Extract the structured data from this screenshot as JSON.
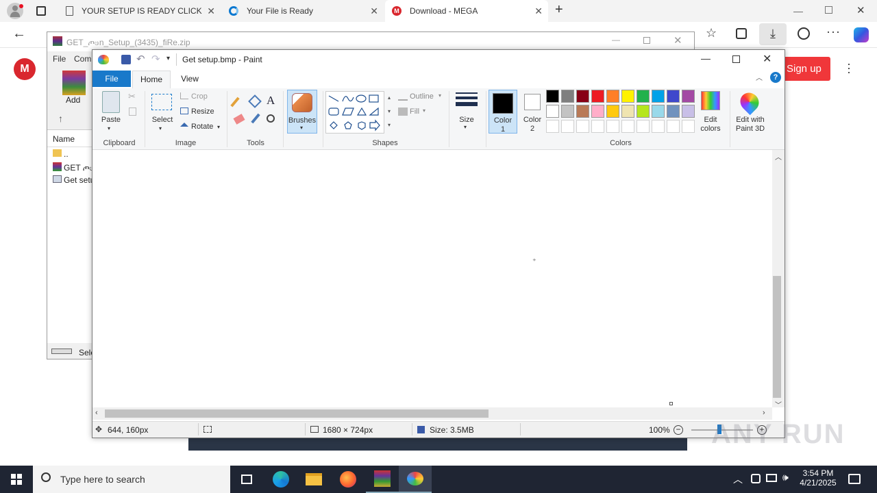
{
  "browser": {
    "tabs": [
      {
        "title": "YOUR SETUP IS READY CLICK BEL",
        "icon": "page-icon"
      },
      {
        "title": "Your File is Ready",
        "icon": "loading-icon"
      },
      {
        "title": "Download - MEGA",
        "icon": "mega-icon"
      }
    ],
    "mega_signup": "Sign up",
    "mega_logo": "M"
  },
  "winrar": {
    "title": "GET_ጦဖn_Setup_(3435)_fiRe.zip",
    "menu": [
      "File",
      "Com"
    ],
    "add_label": "Add",
    "column_name": "Name",
    "files": [
      "..",
      "GET ጦဖ",
      "Get setu"
    ],
    "status": "Sele"
  },
  "paint": {
    "title": "Get setup.bmp - Paint",
    "tabs": {
      "file": "File",
      "home": "Home",
      "view": "View"
    },
    "clipboard": {
      "paste": "Paste",
      "label": "Clipboard"
    },
    "image": {
      "select": "Select",
      "crop": "Crop",
      "resize": "Resize",
      "rotate": "Rotate",
      "label": "Image"
    },
    "tools": {
      "label": "Tools"
    },
    "brushes": "Brushes",
    "shapes": {
      "outline": "Outline",
      "fill": "Fill",
      "label": "Shapes"
    },
    "size": "Size",
    "color1": "Color 1",
    "color2": "Color 2",
    "colors_label": "Colors",
    "edit_colors": "Edit colors",
    "edit_3d": "Edit with Paint 3D",
    "palette": [
      "#000000",
      "#7f7f7f",
      "#880015",
      "#ed1c24",
      "#ff7f27",
      "#fff200",
      "#22b14c",
      "#00a2e8",
      "#3f48cc",
      "#a349a4",
      "#ffffff",
      "#c3c3c3",
      "#b97a57",
      "#ffaec9",
      "#ffc90e",
      "#efe4b0",
      "#b5e61d",
      "#99d9ea",
      "#7092be",
      "#c8bfe7"
    ],
    "status": {
      "cursor": "644, 160px",
      "dimensions": "1680 × 724px",
      "size": "Size: 3.5MB",
      "zoom": "100%"
    }
  },
  "taskbar": {
    "search_placeholder": "Type here to search",
    "time": "3:54 PM",
    "date": "4/21/2025"
  },
  "watermark": "ANY RUN"
}
